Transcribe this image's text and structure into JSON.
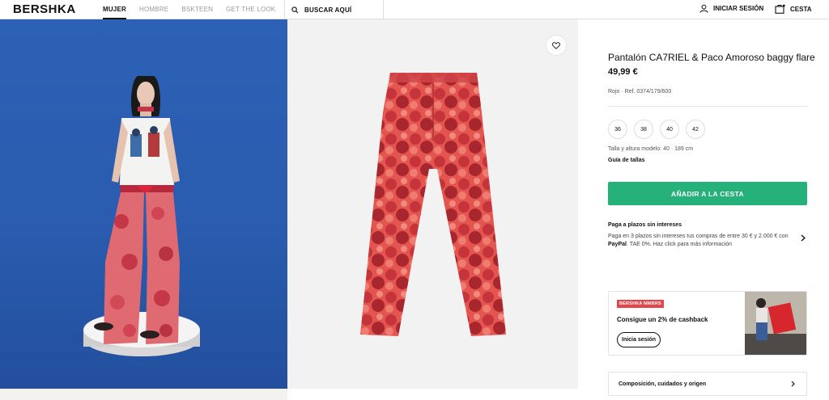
{
  "header": {
    "logo": "BERSHKA",
    "nav": [
      "MUJER",
      "HOMBRE",
      "BSKTEEN",
      "GET THE LOOK"
    ],
    "search_label": "BUSCAR AQUÍ",
    "login_label": "INICIAR SESIÓN",
    "cart_label": "CESTA"
  },
  "product": {
    "title": "Pantalón CA7RIEL & Paco Amoroso baggy flare",
    "price": "49,99 €",
    "ref": "Rojo · Ref. 0374/179/600",
    "sizes": [
      "36",
      "38",
      "40",
      "42"
    ],
    "model_info": "Talla y altura modelo: 40 · 189 cm",
    "size_guide": "Guía de tallas",
    "add_to_cart": "AÑADIR A LA CESTA"
  },
  "payment": {
    "title": "Paga a plazos sin intereses",
    "text_before": "Paga en 3 plazos sin intereses tus compras de entre 30 € y 2.000 € con ",
    "brand": "PayPal",
    "text_after": ". TAE 0%. Haz click para más información"
  },
  "promo": {
    "badge": "BERSHKA MMBRS",
    "text": "Consigue un 2% de cashback",
    "button": "Inicia sesión"
  },
  "composition": {
    "label": "Composición, cuidados y origen"
  },
  "colors": {
    "accent": "#26b17b",
    "badge": "#e0474c",
    "model_bg": "#2a5caf"
  }
}
